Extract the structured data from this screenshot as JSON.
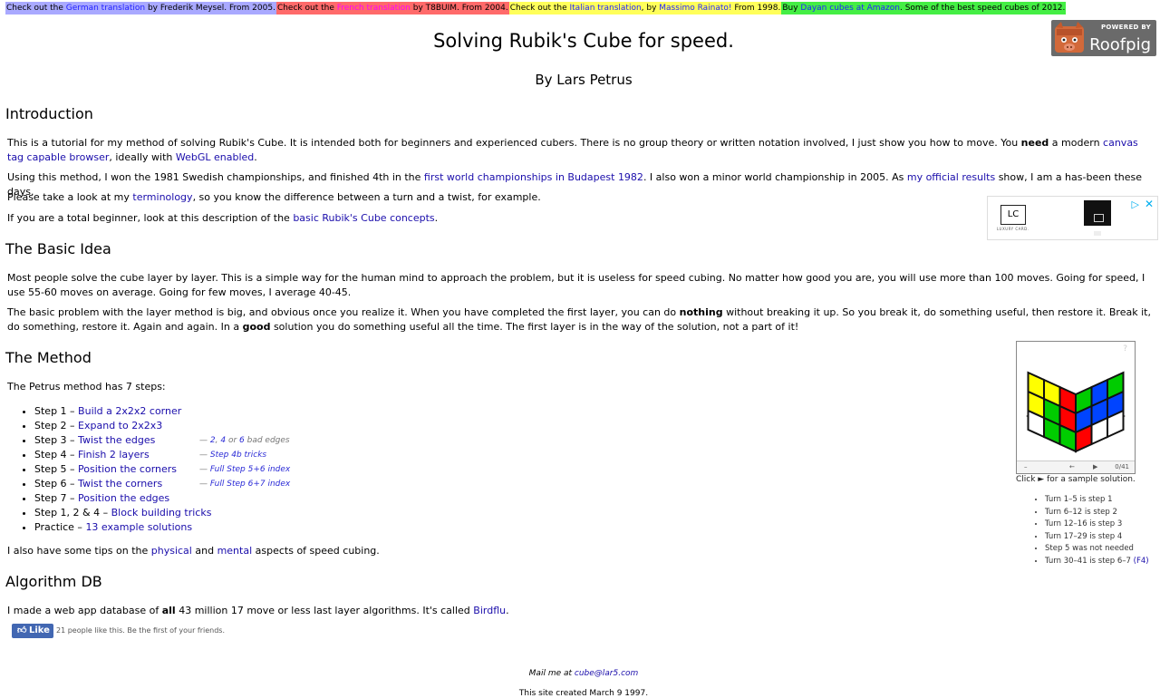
{
  "banner": [
    {
      "pre": "Check out the ",
      "link": "German translation",
      "post": " by Frederik Meysel. From 2005."
    },
    {
      "pre": "Check out the ",
      "link": "French translation",
      "post": " by T8BUIM. From 2004."
    },
    {
      "pre": "Check out the ",
      "link": "Italian translation",
      "mid": ", by ",
      "link2": "Massimo Rainato!",
      "post": " From 1998."
    },
    {
      "pre": "Buy ",
      "link": "Dayan cubes at Amazon",
      "post": ". Some of the best speed cubes of 2012."
    }
  ],
  "title": "Solving Rubik's Cube for speed.",
  "author": "By Lars Petrus",
  "logo": {
    "powered": "POWERED BY",
    "name": "Roofpig",
    "icon": "pig-icon"
  },
  "intro": {
    "heading": "Introduction",
    "p1": {
      "a": "This is a tutorial for my method of solving Rubik's Cube. It is intended both for beginners and experienced cubers. There is no group theory or written notation involved, I just show you how to move. You ",
      "b": "need",
      "c": " a modern ",
      "link1": "canvas tag capable browser",
      "d": ", ideally with ",
      "link2": "WebGL enabled",
      "e": "."
    },
    "p2": {
      "a": "Using this method, I won the 1981 Swedish championships, and finished 4th in the ",
      "link1": "first world championships in Budapest 1982",
      "b": ". I also won a minor world championship in 2005. As ",
      "link2": "my official results",
      "c": " show, I am a has-been these days."
    },
    "p3": {
      "a": "Please take a look at my ",
      "link": "terminology",
      "b": ", so you know the difference between a turn and a twist, for example."
    },
    "p4": {
      "a": "If you are a total beginner, look at this description of the ",
      "link": "basic Rubik's Cube concepts",
      "b": "."
    }
  },
  "ad": {
    "logo": "LC",
    "caption": "LUXURY CARD.",
    "card_logo": "LC",
    "choices": "▷",
    "close": "✕"
  },
  "basic": {
    "heading": "The Basic Idea",
    "p1": "Most people solve the cube layer by layer. This is a simple way for the human mind to approach the problem, but it is useless for speed cubing. No matter how good you are, you will use more than 100 moves. Going for speed, I use 55-60 moves on average. Going for few moves, I average 40-45.",
    "p2": {
      "a": "The basic problem with the layer method is big, and obvious once you realize it. When you have completed the first layer, you can do ",
      "b": "nothing",
      "c": " without breaking it up. So you break it, do something useful, then restore it. Break it, do something, restore it. Again and again. In a ",
      "d": "good",
      "e": " solution you do something useful all the time. The first layer is in the way of the solution, not a part of it!"
    }
  },
  "method": {
    "heading": "The Method",
    "intro": "The Petrus method has 7 steps:",
    "steps": [
      {
        "label": "Step 1 – ",
        "link": "Build a 2x2x2 corner"
      },
      {
        "label": "Step 2 – ",
        "link": "Expand to 2x2x3"
      },
      {
        "label": "Step 3 – ",
        "link": "Twist the edges",
        "note": {
          "pre": "— ",
          "l1": "2",
          "s1": ", ",
          "l2": "4",
          "s2": " or ",
          "l3": "6",
          "post": " bad edges"
        }
      },
      {
        "label": "Step 4 – ",
        "link": "Finish 2 layers",
        "note": {
          "pre": "— ",
          "l1": "Step 4b tricks"
        }
      },
      {
        "label": "Step 5 – ",
        "link": "Position the corners",
        "note": {
          "pre": "— ",
          "l1": "Full Step 5+6 index"
        }
      },
      {
        "label": "Step 6 – ",
        "link": "Twist the corners",
        "note": {
          "pre": "— ",
          "l1": "Full Step 6+7 index"
        }
      },
      {
        "label": "Step 7 – ",
        "link": "Position the edges"
      },
      {
        "label": "Step 1, 2 & 4 – ",
        "link": "Block building tricks"
      },
      {
        "label": "Practice – ",
        "link": "13 example solutions"
      }
    ],
    "tips": {
      "a": "I also have some tips on the ",
      "link1": "physical",
      "b": " and ",
      "link2": "mental",
      "c": " aspects of speed cubing."
    }
  },
  "cube": {
    "help": "?",
    "counter": "0/41",
    "ctrl_prev": "–",
    "ctrl_step": "←",
    "ctrl_play": "▶",
    "caption": "Click ► for a sample solution.",
    "turns": [
      {
        "text": "Turn 1–5 is step 1"
      },
      {
        "text": "Turn 6–12 is step 2"
      },
      {
        "text": "Turn 12–16 is step 3"
      },
      {
        "text": "Turn 17–29 is step 4"
      },
      {
        "text": "Step 5 was not needed"
      },
      {
        "text": "Turn 30–41 is step 6–7 ",
        "link": "(F4)"
      }
    ],
    "colors": {
      "white": "#ffffff",
      "yellow": "#ffff00",
      "red": "#ff0000",
      "green": "#00cc00",
      "blue": "#0044ff",
      "orange": "#ff8800"
    }
  },
  "algdb": {
    "heading": "Algorithm DB",
    "p": {
      "a": "I made a web app database of ",
      "b": "all",
      "c": " 43 million 17 move or less last layer algorithms. It's called ",
      "link": "Birdflu",
      "d": "."
    }
  },
  "like": {
    "button": "Like",
    "icon": "thumbs-up-icon",
    "text": "21 people like this. Be the first of your friends."
  },
  "footer": {
    "mail_pre": "Mail me at ",
    "mail_link": "cube@lar5.com",
    "created": "This site created March 9 1997."
  }
}
